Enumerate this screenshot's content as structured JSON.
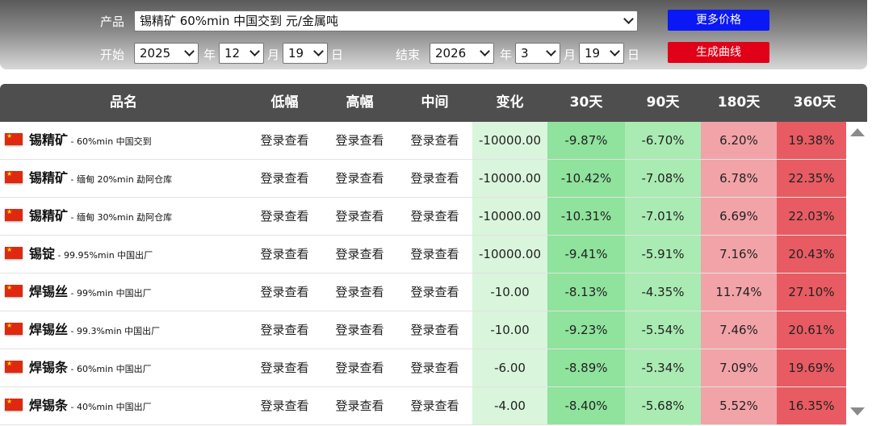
{
  "controls": {
    "product_label": "产品",
    "product_value": "锡精矿 60%min 中国交到 元/金属吨",
    "more_prices_button": "更多价格",
    "start_label": "开始",
    "start_year": "2025",
    "start_month": "12",
    "start_day": "19",
    "end_label": "结束",
    "end_year": "2026",
    "end_month": "3",
    "end_day": "19",
    "year_unit": "年",
    "month_unit": "月",
    "day_unit": "日",
    "generate_button": "生成曲线"
  },
  "table": {
    "headers": [
      "品名",
      "低幅",
      "高幅",
      "中间",
      "变化",
      "30天",
      "90天",
      "180天",
      "360天"
    ],
    "rows": [
      {
        "name": "锡精矿",
        "spec": "60%min 中国交到",
        "low": "登录查看",
        "high": "登录查看",
        "mid": "登录查看",
        "change": "-10000.00",
        "d30": "-9.87%",
        "d90": "-6.70%",
        "d180": "6.20%",
        "d360": "19.38%"
      },
      {
        "name": "锡精矿",
        "spec": "缅甸 20%min 勐阿仓库",
        "low": "登录查看",
        "high": "登录查看",
        "mid": "登录查看",
        "change": "-10000.00",
        "d30": "-10.42%",
        "d90": "-7.08%",
        "d180": "6.78%",
        "d360": "22.35%"
      },
      {
        "name": "锡精矿",
        "spec": "缅甸 30%min 勐阿仓库",
        "low": "登录查看",
        "high": "登录查看",
        "mid": "登录查看",
        "change": "-10000.00",
        "d30": "-10.31%",
        "d90": "-7.01%",
        "d180": "6.69%",
        "d360": "22.03%"
      },
      {
        "name": "锡锭",
        "spec": "99.95%min 中国出厂",
        "low": "登录查看",
        "high": "登录查看",
        "mid": "登录查看",
        "change": "-10000.00",
        "d30": "-9.41%",
        "d90": "-5.91%",
        "d180": "7.16%",
        "d360": "20.43%"
      },
      {
        "name": "焊锡丝",
        "spec": "99%min 中国出厂",
        "low": "登录查看",
        "high": "登录查看",
        "mid": "登录查看",
        "change": "-10.00",
        "d30": "-8.13%",
        "d90": "-4.35%",
        "d180": "11.74%",
        "d360": "27.10%"
      },
      {
        "name": "焊锡丝",
        "spec": "99.3%min 中国出厂",
        "low": "登录查看",
        "high": "登录查看",
        "mid": "登录查看",
        "change": "-10.00",
        "d30": "-9.23%",
        "d90": "-5.54%",
        "d180": "7.46%",
        "d360": "20.61%"
      },
      {
        "name": "焊锡条",
        "spec": "60%min 中国出厂",
        "low": "登录查看",
        "high": "登录查看",
        "mid": "登录查看",
        "change": "-6.00",
        "d30": "-8.89%",
        "d90": "-5.34%",
        "d180": "7.09%",
        "d360": "19.69%"
      },
      {
        "name": "焊锡条",
        "spec": "40%min 中国出厂",
        "low": "登录查看",
        "high": "登录查看",
        "mid": "登录查看",
        "change": "-4.00",
        "d30": "-8.40%",
        "d90": "-5.68%",
        "d180": "5.52%",
        "d360": "16.35%"
      }
    ]
  },
  "colors": {
    "header_bg": "#4e4e4e",
    "change_bg": "#d9f5db",
    "negative_bg": "#8fe39d",
    "positive_bg": "#e85b62",
    "more_button_bg": "#0a18f5",
    "generate_button_bg": "#e00018"
  },
  "icons": [
    "china-flag-icon",
    "chevron-down-icon",
    "scroll-up-arrow-icon",
    "scroll-down-arrow-icon"
  ]
}
